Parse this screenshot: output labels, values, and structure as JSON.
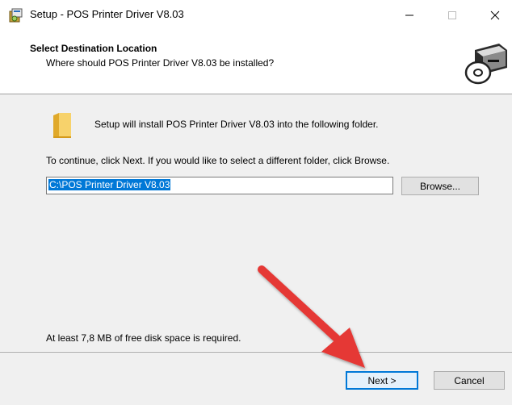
{
  "window": {
    "title": "Setup - POS Printer Driver V8.03",
    "controls": {
      "minimize": "—",
      "maximize": "☐",
      "close": "✕"
    }
  },
  "header": {
    "title": "Select Destination Location",
    "subtitle": "Where should POS Printer Driver V8.03 be installed?",
    "image_icon": "printer-cd-icon"
  },
  "content": {
    "folder_icon": "folder-icon",
    "info_text": "Setup will install POS Printer Driver V8.03 into the following folder.",
    "continue_text": "To continue, click Next. If you would like to select a different folder, click Browse.",
    "path_value": "C:\\POS Printer Driver V8.03",
    "browse_label": "Browse...",
    "disk_space_text": "At least 7,8 MB of free disk space is required."
  },
  "footer": {
    "next_label": "Next >",
    "cancel_label": "Cancel"
  },
  "colors": {
    "selection": "#0078d7",
    "arrow": "#e53935",
    "panel": "#f0f0f0"
  }
}
